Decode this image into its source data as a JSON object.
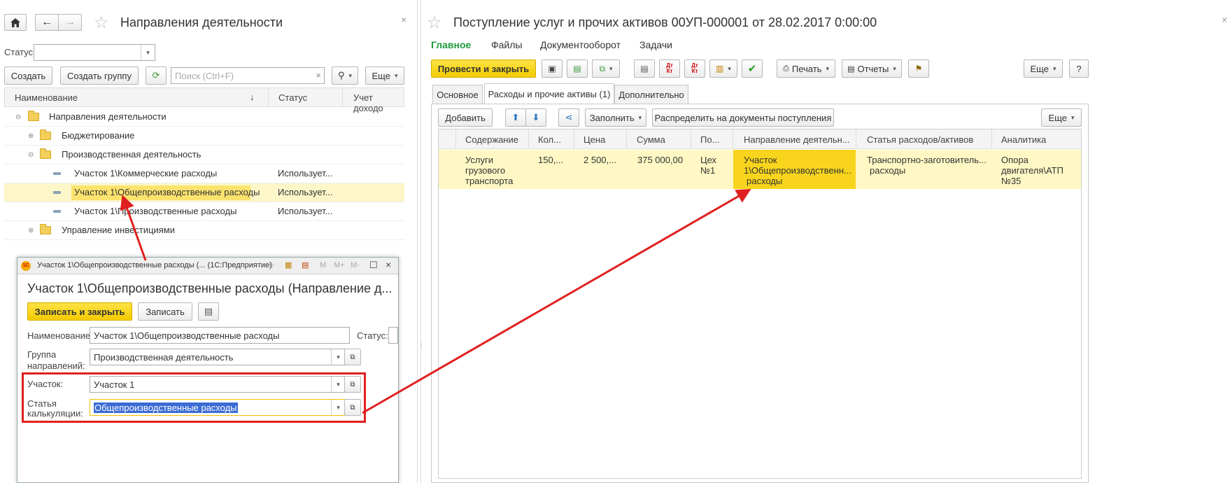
{
  "left": {
    "title": "Направления деятельности",
    "status_label": "Статус:",
    "status_value": "",
    "create_btn": "Создать",
    "create_group_btn": "Создать группу",
    "search_placeholder": "Поиск (Ctrl+F)",
    "more_btn": "Еще",
    "columns": {
      "name": "Наименование",
      "status": "Статус",
      "income": "Учет доходо"
    },
    "rows": [
      {
        "label": "Направления деятельности",
        "status": ""
      },
      {
        "label": "Бюджетирование",
        "status": ""
      },
      {
        "label": "Производственная деятельность",
        "status": ""
      },
      {
        "label": "Участок 1\\Коммерческие расходы",
        "status": "Использует..."
      },
      {
        "label": "Участок 1\\Общепроизводственные расходы",
        "status": "Использует..."
      },
      {
        "label": "Участок 1\\Производственные расходы",
        "status": "Использует..."
      },
      {
        "label": "Управление инвестициями",
        "status": ""
      }
    ]
  },
  "popup": {
    "window_title": "Участок 1\\Общепроизводственные расходы (...  (1С:Предприятие)",
    "heading": "Участок 1\\Общепроизводственные расходы (Направление д...",
    "save_close_btn": "Записать и закрыть",
    "save_btn": "Записать",
    "name_label": "Наименование:",
    "name_value": "Участок 1\\Общепроизводственные расходы",
    "status_label": "Статус:",
    "group_label_1": "Группа",
    "group_label_2": "направлений:",
    "group_value": "Производственная деятельность",
    "section_label": "Участок:",
    "section_value": "Участок 1",
    "article_label_1": "Статья",
    "article_label_2": "калькуляции:",
    "article_value": "Общепроизводственные расходы",
    "title_icons": [
      "M",
      "M+",
      "M-"
    ]
  },
  "right": {
    "title": "Поступление услуг и прочих активов 00УП-000001 от 28.02.2017 0:00:00",
    "nav": [
      "Главное",
      "Файлы",
      "Документооборот",
      "Задачи"
    ],
    "post_close_btn": "Провести и закрыть",
    "print_btn": "Печать",
    "reports_btn": "Отчеты",
    "more_btn": "Еще",
    "help_btn": "?",
    "tabs": [
      "Основное",
      "Расходы и прочие активы (1)",
      "Дополнительно"
    ],
    "add_btn": "Добавить",
    "fill_btn": "Заполнить",
    "distribute_btn": "Распределить на документы поступления",
    "grid_more_btn": "Еще",
    "columns": [
      "Содержание",
      "Кол...",
      "Цена",
      "Сумма",
      "По...",
      "Направление деятельн...",
      "Статья расходов/активов",
      "Аналитика"
    ],
    "row": {
      "content": [
        "Услуги",
        "грузового",
        "транспорта"
      ],
      "qty": "150,...",
      "price": "2 500,...",
      "sum": "375 000,00",
      "dept": [
        "Цех",
        "№1"
      ],
      "direction": [
        "Участок",
        "1\\Общепроизводственн...",
        "расходы"
      ],
      "article": [
        "Транспортно-заготовитель...",
        "расходы"
      ],
      "analytics": [
        "Опора",
        "двигателя\\АТП",
        "№35"
      ]
    },
    "icon_labels": {
      "dt_ct": "Дт Кт",
      "at_kt": "Дт Кт"
    }
  },
  "colors": {
    "accent_green": "#1e9c3c",
    "yellow": "#f5cc00",
    "selected_row": "#fff8c4",
    "arrow_red": "#e02020"
  }
}
